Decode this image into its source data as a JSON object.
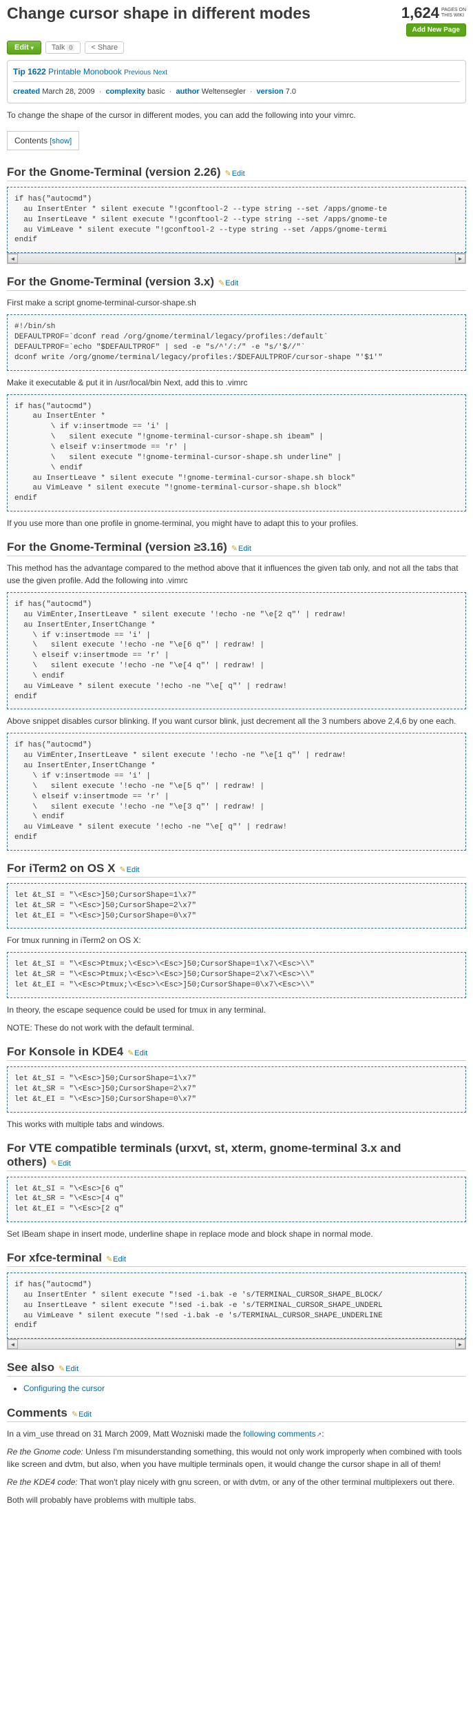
{
  "header": {
    "title": "Change cursor shape in different modes",
    "pageCount": "1,624",
    "pagesLabel1": "PAGES ON",
    "pagesLabel2": "THIS WIKI",
    "addBtn": "Add New Page"
  },
  "actions": {
    "edit": "Edit",
    "talk": "Talk",
    "talkCount": "0",
    "share": "Share"
  },
  "tip": {
    "prefix": "Tip 1622",
    "printable": "Printable Monobook",
    "prev": "Previous",
    "next": "Next"
  },
  "meta": {
    "createdLbl": "created",
    "created": "March 28, 2009",
    "complexityLbl": "complexity",
    "complexity": "basic",
    "authorLbl": "author",
    "author": "Weltensegler",
    "versionLbl": "version",
    "version": "7.0"
  },
  "intro": "To change the shape of the cursor in different modes, you can add the following into your vimrc.",
  "toc": {
    "contents": "Contents",
    "show": "[show]"
  },
  "editLink": "Edit",
  "sections": {
    "gnome226": {
      "title": "For the Gnome-Terminal (version 2.26)",
      "code": "if has(\"autocmd\")\n  au InsertEnter * silent execute \"!gconftool-2 --type string --set /apps/gnome-te\n  au InsertLeave * silent execute \"!gconftool-2 --type string --set /apps/gnome-te\n  au VimLeave * silent execute \"!gconftool-2 --type string --set /apps/gnome-termi\nendif"
    },
    "gnome3x": {
      "title": "For the Gnome-Terminal (version 3.x)",
      "p1": "First make a script gnome-terminal-cursor-shape.sh",
      "code1": "#!/bin/sh\nDEFAULTPROF=`dconf read /org/gnome/terminal/legacy/profiles:/default`\nDEFAULTPROF=`echo \"$DEFAULTPROF\" | sed -e \"s/^'/:/\" -e \"s/'$//\"`\ndconf write /org/gnome/terminal/legacy/profiles:/$DEFAULTPROF/cursor-shape \"'$1'\"",
      "p2": "Make it executable & put it in /usr/local/bin Next, add this to .vimrc",
      "code2": "if has(\"autocmd\")\n    au InsertEnter *\n        \\ if v:insertmode == 'i' |\n        \\   silent execute \"!gnome-terminal-cursor-shape.sh ibeam\" |\n        \\ elseif v:insertmode == 'r' |\n        \\   silent execute \"!gnome-terminal-cursor-shape.sh underline\" |\n        \\ endif\n    au InsertLeave * silent execute \"!gnome-terminal-cursor-shape.sh block\"\n    au VimLeave * silent execute \"!gnome-terminal-cursor-shape.sh block\"\nendif",
      "p3": "If you use more than one profile in gnome-terminal, you might have to adapt this to your profiles."
    },
    "gnome316": {
      "title": "For the Gnome-Terminal (version ≥3.16)",
      "p1": "This method has the advantage compared to the method above that it influences the given tab only, and not all the tabs that use the given profile. Add the following into .vimrc",
      "code1": "if has(\"autocmd\")\n  au VimEnter,InsertLeave * silent execute '!echo -ne \"\\e[2 q\"' | redraw!\n  au InsertEnter,InsertChange *\n    \\ if v:insertmode == 'i' |\n    \\   silent execute '!echo -ne \"\\e[6 q\"' | redraw! |\n    \\ elseif v:insertmode == 'r' |\n    \\   silent execute '!echo -ne \"\\e[4 q\"' | redraw! |\n    \\ endif\n  au VimLeave * silent execute '!echo -ne \"\\e[ q\"' | redraw!\nendif",
      "p2": "Above snippet disables cursor blinking. If you want cursor blink, just decrement all the 3 numbers above 2,4,6 by one each.",
      "code2": "if has(\"autocmd\")\n  au VimEnter,InsertLeave * silent execute '!echo -ne \"\\e[1 q\"' | redraw!\n  au InsertEnter,InsertChange *\n    \\ if v:insertmode == 'i' |\n    \\   silent execute '!echo -ne \"\\e[5 q\"' | redraw! |\n    \\ elseif v:insertmode == 'r' |\n    \\   silent execute '!echo -ne \"\\e[3 q\"' | redraw! |\n    \\ endif\n  au VimLeave * silent execute '!echo -ne \"\\e[ q\"' | redraw!\nendif"
    },
    "iterm2": {
      "title": "For iTerm2 on OS X",
      "code1": "let &t_SI = \"\\<Esc>]50;CursorShape=1\\x7\"\nlet &t_SR = \"\\<Esc>]50;CursorShape=2\\x7\"\nlet &t_EI = \"\\<Esc>]50;CursorShape=0\\x7\"",
      "p1": "For tmux running in iTerm2 on OS X:",
      "code2": "let &t_SI = \"\\<Esc>Ptmux;\\<Esc>\\<Esc>]50;CursorShape=1\\x7\\<Esc>\\\\\"\nlet &t_SR = \"\\<Esc>Ptmux;\\<Esc>\\<Esc>]50;CursorShape=2\\x7\\<Esc>\\\\\"\nlet &t_EI = \"\\<Esc>Ptmux;\\<Esc>\\<Esc>]50;CursorShape=0\\x7\\<Esc>\\\\\"",
      "p2": "In theory, the escape sequence could be used for tmux in any terminal.",
      "p3": "NOTE: These do not work with the default terminal."
    },
    "konsole": {
      "title": "For Konsole in KDE4",
      "code": "let &t_SI = \"\\<Esc>]50;CursorShape=1\\x7\"\nlet &t_SR = \"\\<Esc>]50;CursorShape=2\\x7\"\nlet &t_EI = \"\\<Esc>]50;CursorShape=0\\x7\"",
      "p1": "This works with multiple tabs and windows."
    },
    "vte": {
      "title": "For VTE compatible terminals (urxvt, st, xterm, gnome-terminal 3.x and others)",
      "code": "let &t_SI = \"\\<Esc>[6 q\"\nlet &t_SR = \"\\<Esc>[4 q\"\nlet &t_EI = \"\\<Esc>[2 q\"",
      "p1": "Set IBeam shape in insert mode, underline shape in replace mode and block shape in normal mode."
    },
    "xfce": {
      "title": "For xfce-terminal",
      "code": "if has(\"autocmd\")\n  au InsertEnter * silent execute \"!sed -i.bak -e 's/TERMINAL_CURSOR_SHAPE_BLOCK/\n  au InsertLeave * silent execute \"!sed -i.bak -e 's/TERMINAL_CURSOR_SHAPE_UNDERL\n  au VimLeave * silent execute \"!sed -i.bak -e 's/TERMINAL_CURSOR_SHAPE_UNDERLINE\nendif"
    },
    "seealso": {
      "title": "See also",
      "link": "Configuring the cursor"
    },
    "comments": {
      "title": "Comments",
      "p1a": "In a vim_use thread on 31 March 2009, Matt Wozniski made the ",
      "p1link": "following comments",
      "p1b": ":",
      "p2a": "Re the Gnome code:",
      "p2b": " Unless I'm misunderstanding something, this would not only work improperly when combined with tools like screen and dvtm, but also, when you have multiple terminals open, it would change the cursor shape in all of them!",
      "p3a": "Re the KDE4 code:",
      "p3b": " That won't play nicely with gnu screen, or with dvtm, or any of the other terminal multiplexers out there.",
      "p4": "Both will probably have problems with multiple tabs."
    }
  }
}
